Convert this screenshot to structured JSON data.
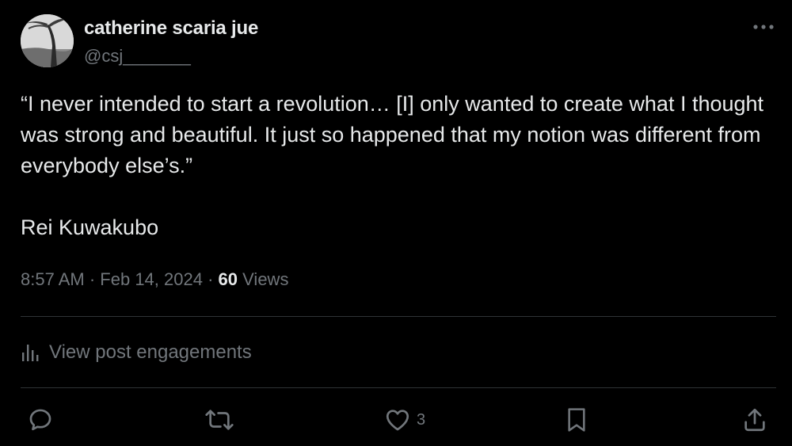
{
  "author": {
    "name": "catherine scaria jue",
    "handle": "@csj_______"
  },
  "post": {
    "text": "“I never intended to start a revolution… [I] only wanted to create what I thought was strong and beautiful. It just so happened that my notion was different from everybody else’s.”",
    "attribution": "Rei Kuwakubo"
  },
  "meta": {
    "time": "8:57 AM",
    "separator": "·",
    "date": "Feb 14, 2024",
    "views_count": "60",
    "views_label": "Views"
  },
  "engagements": {
    "label": "View post engagements",
    "icon": "analytics-icon"
  },
  "actions": {
    "reply": {
      "icon": "reply-icon",
      "count": ""
    },
    "repost": {
      "icon": "repost-icon",
      "count": ""
    },
    "like": {
      "icon": "heart-icon",
      "count": "3"
    },
    "bookmark": {
      "icon": "bookmark-icon",
      "count": ""
    },
    "share": {
      "icon": "share-icon",
      "count": ""
    }
  },
  "colors": {
    "background": "#000000",
    "primary_text": "#e7e9ea",
    "secondary_text": "#71767b",
    "divider": "#2f3336"
  }
}
